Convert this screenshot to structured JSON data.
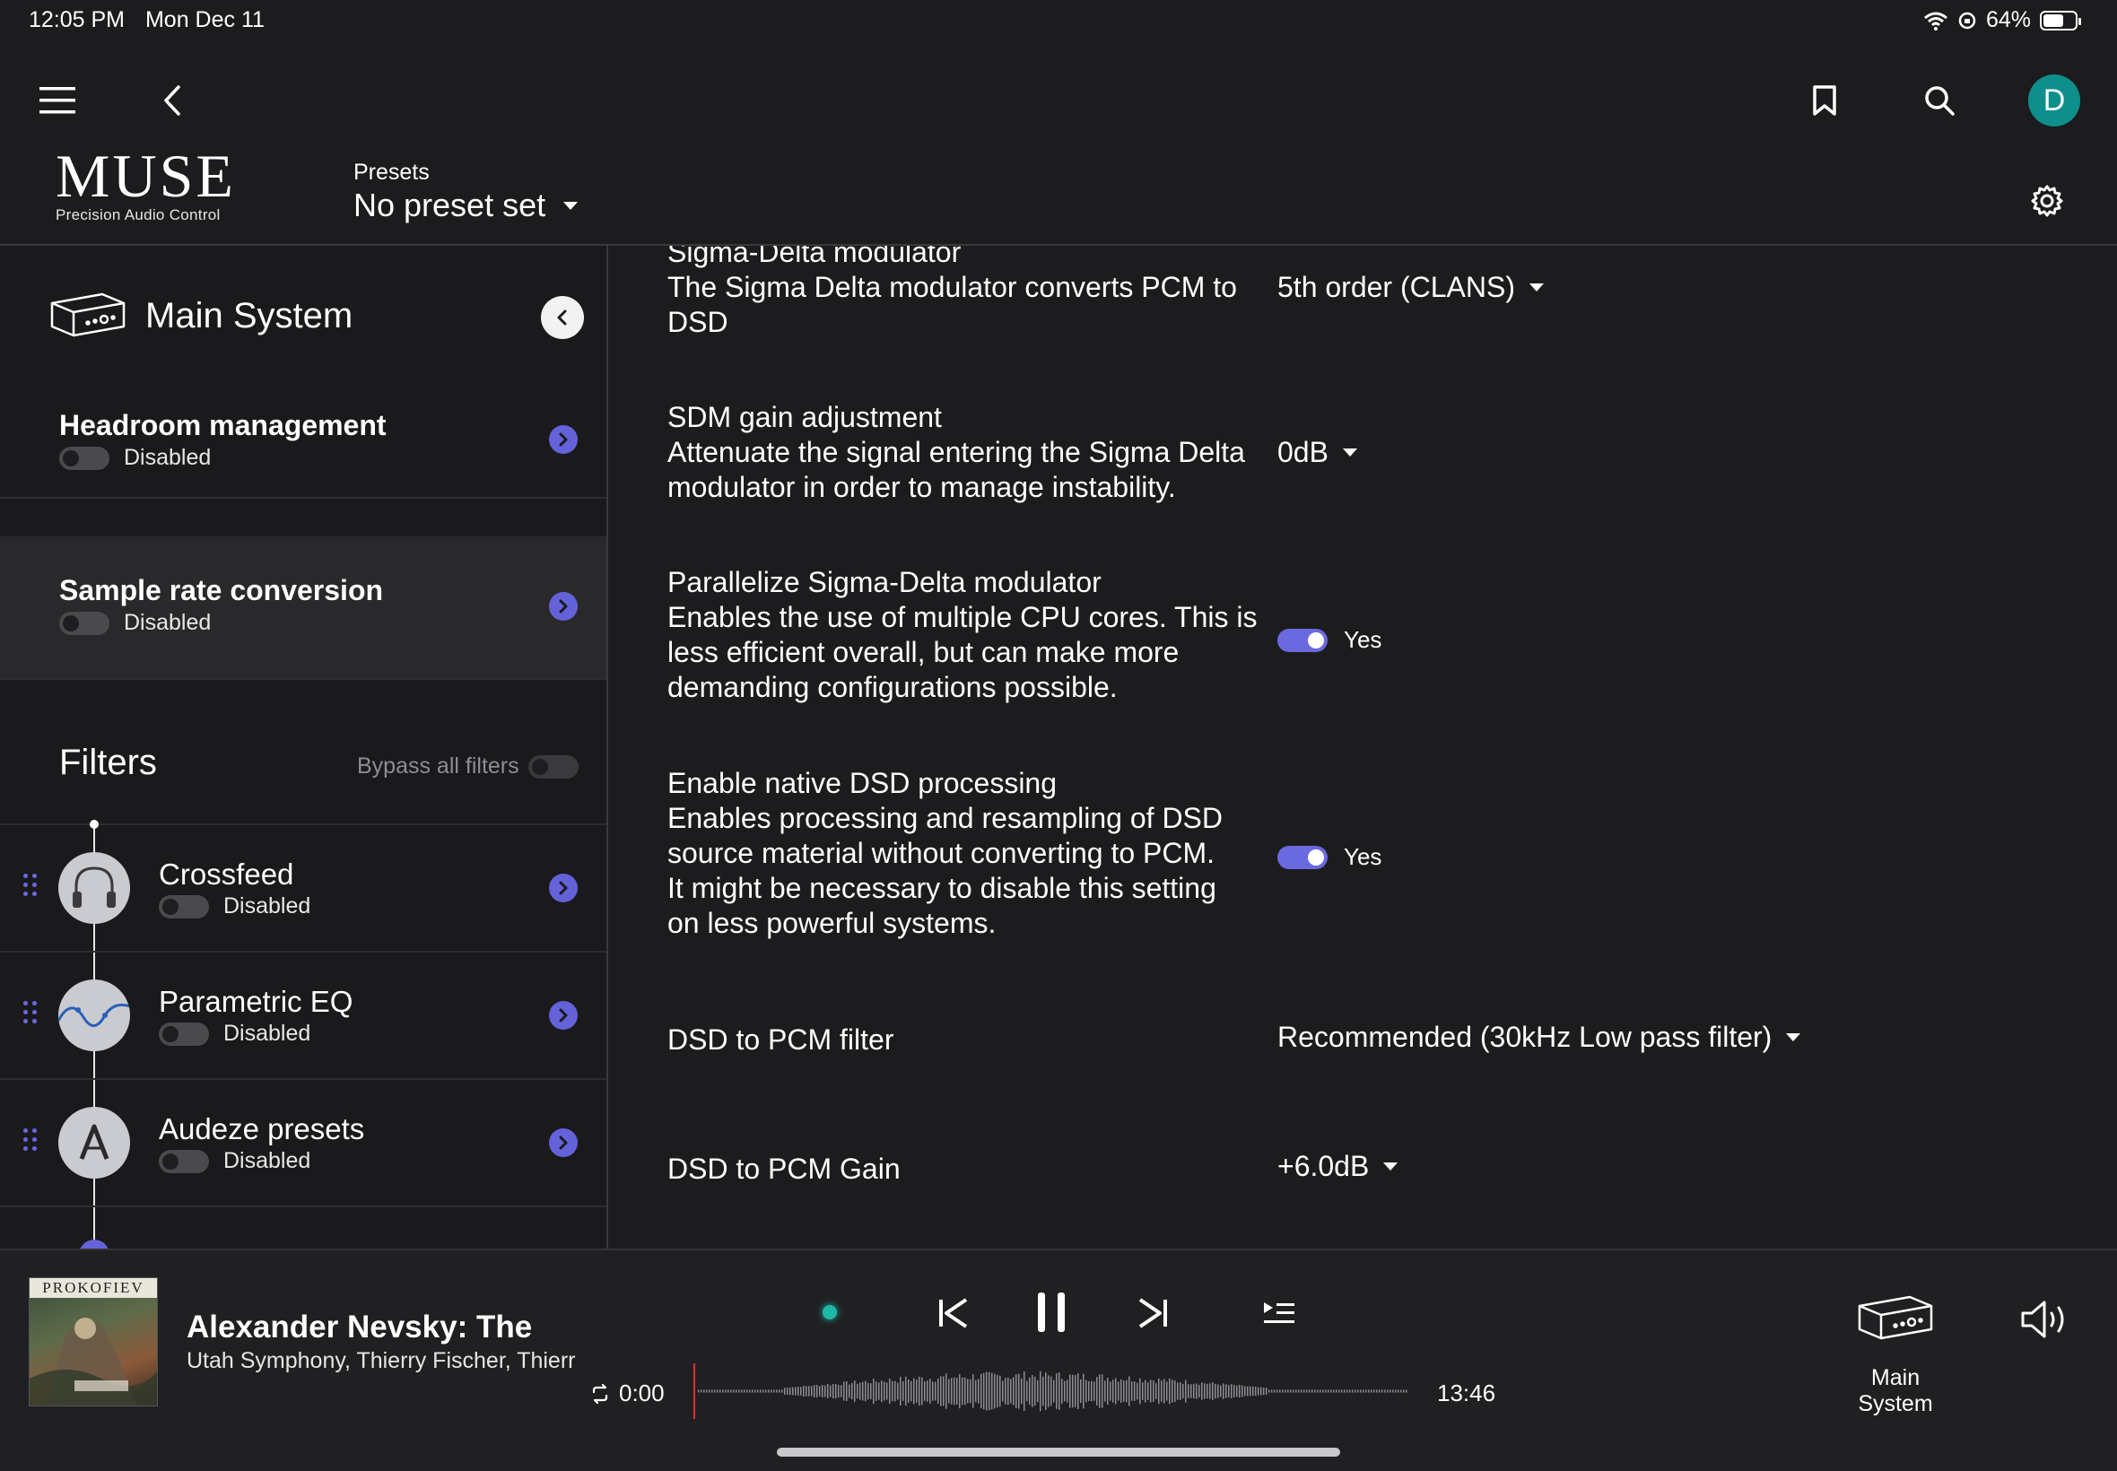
{
  "status_bar": {
    "time": "12:05 PM",
    "date": "Mon Dec 11",
    "battery_text": "64%",
    "battery_level": 0.64
  },
  "header": {
    "logo_main": "MUSE",
    "logo_sub": "Precision Audio Control",
    "presets_label": "Presets",
    "presets_value": "No preset set",
    "avatar_letter": "D",
    "avatar_color": "#0e8f8c",
    "icons": [
      "menu-icon",
      "back-icon",
      "bookmark-icon",
      "search-icon",
      "settings-gear-icon"
    ]
  },
  "sidebar": {
    "system_name": "Main System",
    "items": [
      {
        "title": "Headroom management",
        "state": "Disabled"
      },
      {
        "title": "Sample rate conversion",
        "state": "Disabled"
      }
    ],
    "filters_heading": "Filters",
    "bypass_label": "Bypass all filters",
    "filters": [
      {
        "title": "Crossfeed",
        "state": "Disabled",
        "icon": "headphones-icon"
      },
      {
        "title": "Parametric EQ",
        "state": "Disabled",
        "icon": "eq-curve-icon"
      },
      {
        "title": "Audeze presets",
        "state": "Disabled",
        "icon": "audeze-logo-icon"
      }
    ]
  },
  "main": {
    "settings": [
      {
        "name": "Sigma-Delta modulator",
        "desc_lines": [
          "The Sigma Delta modulator converts PCM to",
          "DSD"
        ],
        "value": "5th order (CLANS)",
        "control": "dropdown"
      },
      {
        "name": "SDM gain adjustment",
        "desc_lines": [
          "Attenuate the signal entering the Sigma Delta",
          "modulator in order to manage instability."
        ],
        "value": "0dB",
        "control": "dropdown"
      },
      {
        "name": "Parallelize Sigma-Delta modulator",
        "desc_lines": [
          "Enables the use of multiple CPU cores. This is",
          "less efficient overall, but can make more",
          "demanding configurations possible."
        ],
        "value": "Yes",
        "control": "toggle"
      },
      {
        "name": "Enable native DSD processing",
        "desc_lines": [
          "Enables processing and resampling of DSD",
          "source material without converting to PCM.",
          "It might be necessary to disable this setting",
          "on less powerful systems."
        ],
        "value": "Yes",
        "control": "toggle"
      },
      {
        "name": "DSD to PCM filter",
        "value": "Recommended (30kHz Low pass filter)",
        "control": "dropdown"
      },
      {
        "name": "DSD to PCM Gain",
        "value": "+6.0dB",
        "control": "dropdown"
      }
    ]
  },
  "player": {
    "album_label": "PROKOFIEV",
    "track_title": "Alexander Nevsky: The",
    "track_artist": "Utah Symphony, Thierry Fischer, Thierr",
    "elapsed": "0:00",
    "duration": "13:46",
    "output_device": "Main System",
    "accent_color": "#1fb8a8"
  }
}
